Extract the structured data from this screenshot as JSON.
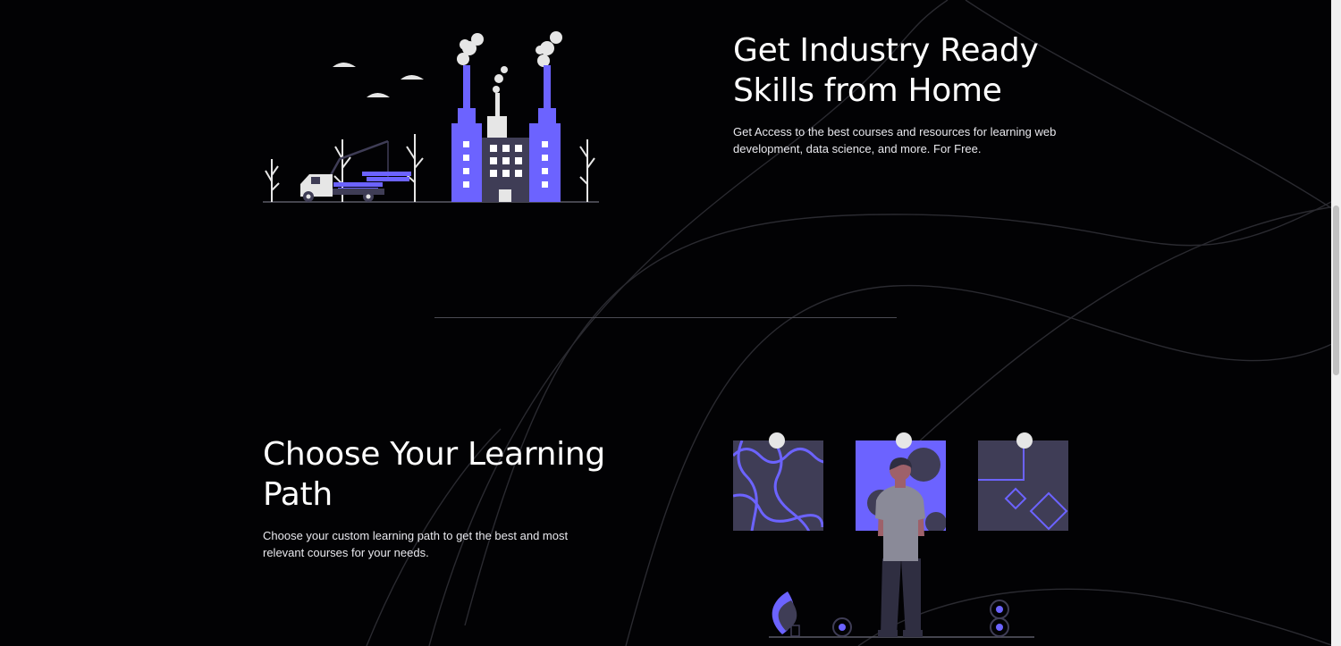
{
  "hero": {
    "heading_line1": "Get Industry Ready",
    "heading_line2": "Skills from Home",
    "description_line1": "Get Access to the best courses and resources for learning web",
    "description_line2": "development, data science, and more. For Free.",
    "illustration_icon": "factory-illustration"
  },
  "path_section": {
    "heading_line1": "Choose Your Learning",
    "heading_line2": "Path",
    "description_line1": "Choose your custom learning path to get the best and most",
    "description_line2": "relevant courses for your needs.",
    "illustration_icon": "art-gallery-illustration"
  },
  "colors": {
    "background": "#020204",
    "accent": "#6c63ff",
    "panel": "#3f3d56",
    "text": "#ffffff"
  }
}
